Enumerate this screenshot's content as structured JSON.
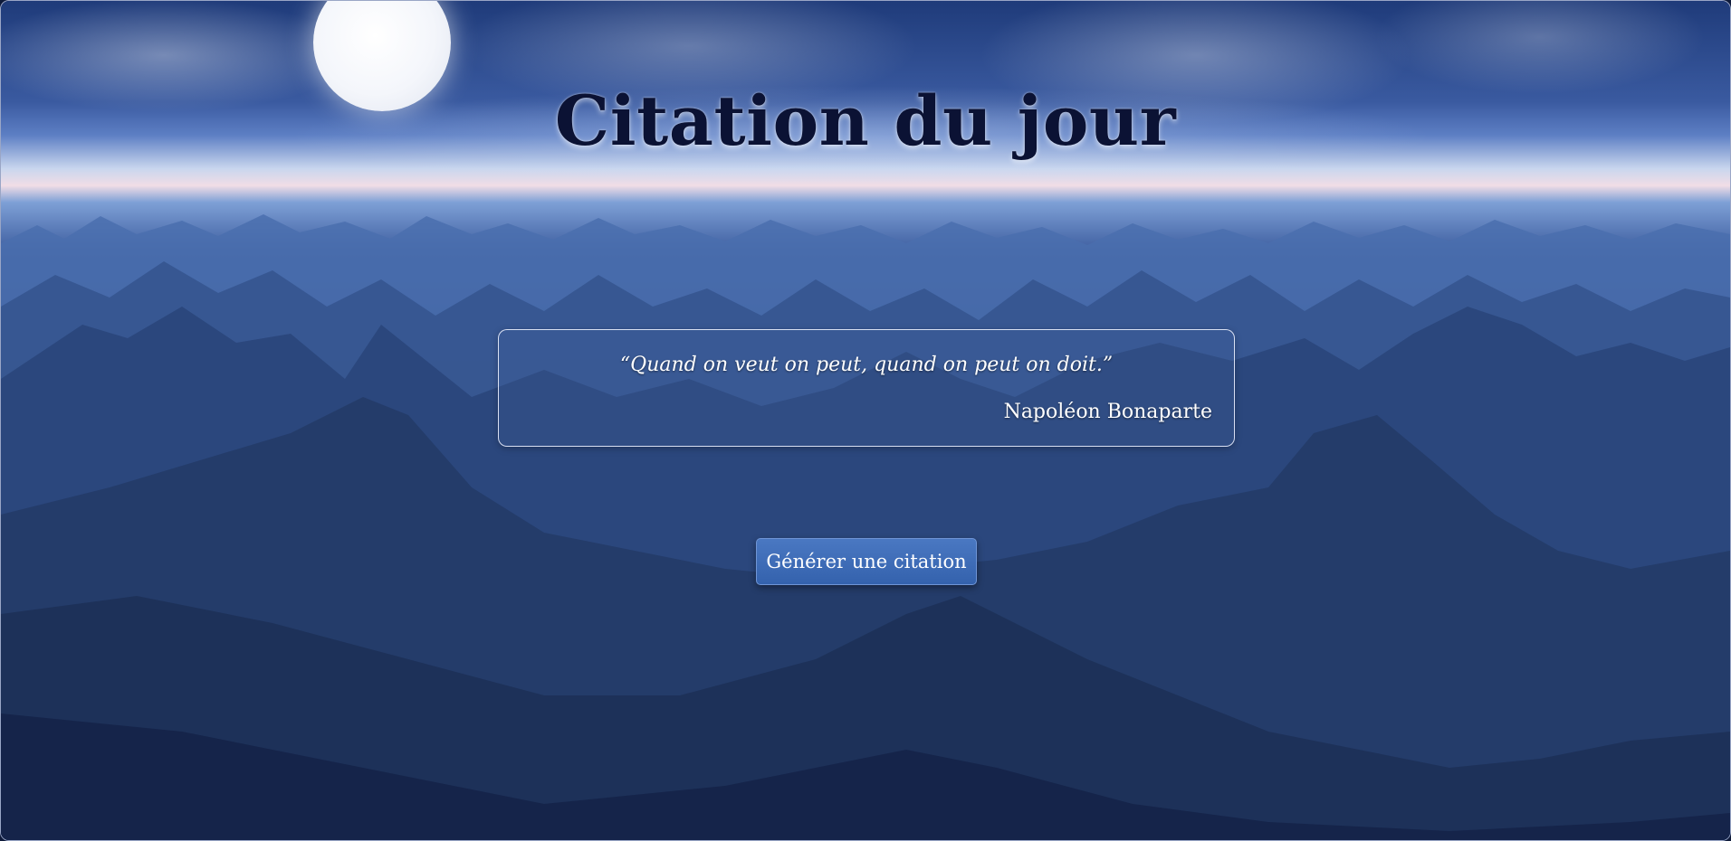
{
  "page": {
    "title": "Citation du jour"
  },
  "quote": {
    "text": "“Quand on veut on peut, quand on peut on doit.”",
    "author": "Napoléon Bonaparte"
  },
  "actions": {
    "generate_label": "Générer une citation"
  },
  "colors": {
    "title": "#0b1234",
    "button_bg": "#3a6ab6",
    "text_light": "#ffffff"
  }
}
